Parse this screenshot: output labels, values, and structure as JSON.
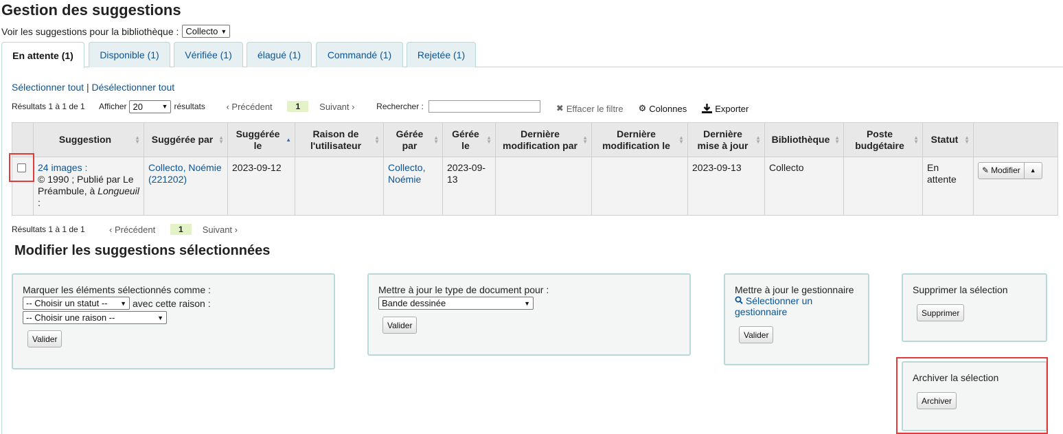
{
  "header": {
    "title": "Gestion des suggestions",
    "library_filter_label": "Voir les suggestions pour la bibliothèque :",
    "library_filter_value": "Collecto"
  },
  "tabs": [
    {
      "label": "En attente (1)",
      "active": true
    },
    {
      "label": "Disponible (1)"
    },
    {
      "label": "Vérifiée (1)"
    },
    {
      "label": "élagué (1)"
    },
    {
      "label": "Commandé (1)"
    },
    {
      "label": "Rejetée (1)"
    }
  ],
  "select_links": {
    "select_all": "Sélectionner tout",
    "separator": "|",
    "deselect_all": "Désélectionner tout"
  },
  "toolbar": {
    "results_info": "Résultats 1 à 1 de 1",
    "show_label": "Afficher",
    "page_size": "20",
    "results_label": "résultats",
    "prev": "‹ Précédent",
    "page": "1",
    "next": "Suivant ›",
    "search_label": "Rechercher :",
    "search_value": "",
    "clear_filter": "Effacer le filtre",
    "columns": "Colonnes",
    "export": "Exporter"
  },
  "table": {
    "columns": [
      "",
      "Suggestion",
      "Suggérée par",
      "Suggérée le",
      "Raison de l'utilisateur",
      "Gérée par",
      "Gérée le",
      "Dernière modification par",
      "Dernière modification le",
      "Dernière mise à jour",
      "Bibliothèque",
      "Poste budgétaire",
      "Statut",
      ""
    ],
    "row": {
      "title": "24 images :",
      "pub_prefix": "© 1990 ; Publié par Le Préambule, à ",
      "pub_place": "Longueuil",
      "pub_suffix": " :",
      "suggested_by": "Collecto, Noémie (221202)",
      "suggested_on": "2023-09-12",
      "user_reason": "",
      "managed_by": "Collecto, Noémie",
      "managed_on": "2023-09-13",
      "last_modified_by": "",
      "last_modified_on": "",
      "last_updated": "2023-09-13",
      "library": "Collecto",
      "budget": "",
      "status": "En attente",
      "edit_label": "Modifier"
    }
  },
  "bottom_toolbar": {
    "results_info": "Résultats 1 à 1 de 1",
    "prev": "‹ Précédent",
    "page": "1",
    "next": "Suivant ›"
  },
  "edit_section": {
    "title": "Modifier les suggestions sélectionnées",
    "mark": {
      "label": "Marquer les éléments sélectionnés comme :",
      "status_select": "-- Choisir un statut --",
      "reason_label": "avec cette raison :",
      "reason_select": "-- Choisir une raison --",
      "submit": "Valider"
    },
    "doctype": {
      "label": "Mettre à jour le type de document pour :",
      "select": "Bande dessinée",
      "submit": "Valider"
    },
    "manager": {
      "label": "Mettre à jour le gestionnaire",
      "link": "Sélectionner un gestionnaire",
      "submit": "Valider"
    },
    "delete": {
      "label": "Supprimer la sélection",
      "submit": "Supprimer"
    },
    "archive": {
      "label": "Archiver la sélection",
      "submit": "Archiver"
    }
  },
  "colors": {
    "link": "#0b5394",
    "tab_bg": "#e6f0f2",
    "border": "#b9d8d9",
    "highlight": "#e03a3a",
    "page_num_bg": "#e4f2c8"
  }
}
